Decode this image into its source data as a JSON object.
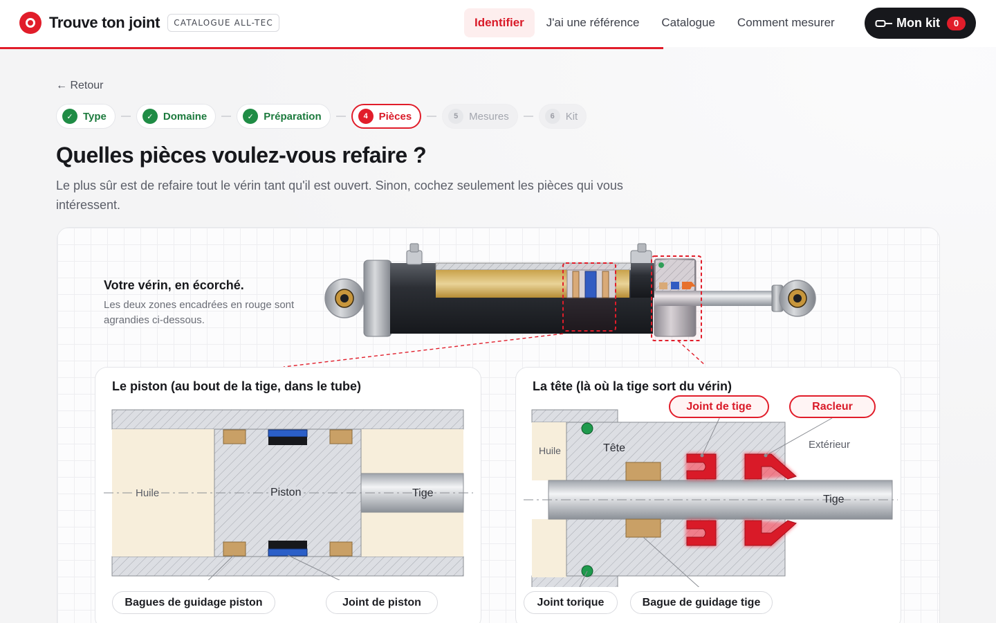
{
  "header": {
    "brand_name": "Trouve ton joint",
    "brand_badge": "CATALOGUE ALL-TEC",
    "nav": [
      {
        "label": "Identifier",
        "active": true
      },
      {
        "label": "J'ai une référence",
        "active": false
      },
      {
        "label": "Catalogue",
        "active": false
      },
      {
        "label": "Comment mesurer",
        "active": false
      }
    ],
    "kit_label": "Mon kit",
    "kit_count": "0",
    "accent": "#e11d2a"
  },
  "page": {
    "back_label": "← Retour",
    "steps": [
      {
        "num": "✓",
        "label": "Type",
        "state": "done"
      },
      {
        "num": "✓",
        "label": "Domaine",
        "state": "done"
      },
      {
        "num": "✓",
        "label": "Préparation",
        "state": "done"
      },
      {
        "num": "4",
        "label": "Pièces",
        "state": "current"
      },
      {
        "num": "5",
        "label": "Mesures",
        "state": "todo"
      },
      {
        "num": "6",
        "label": "Kit",
        "state": "todo"
      }
    ],
    "title": "Quelles pièces voulez-vous refaire ?",
    "lead": "Le plus sûr est de refaire tout le vérin tant qu'il est ouvert. Sinon, cochez seulement les pièces qui vous intéressent."
  },
  "overview": {
    "title": "Votre vérin, en écorché.",
    "subtitle": "Les deux zones encadrées en rouge sont agrandies ci-dessous."
  },
  "piston_panel": {
    "title": "Le piston (au bout de la tige, dans le tube)",
    "label_oil": "Huile",
    "label_piston": "Piston",
    "label_rod": "Tige",
    "pill_guide": "Bagues de guidage piston",
    "pill_seal": "Joint de piston"
  },
  "head_panel": {
    "title": "La tête (là où la tige sort du vérin)",
    "label_oil": "Huile",
    "label_head": "Tête",
    "label_outside": "Extérieur",
    "label_rod": "Tige",
    "pill_rod_seal": "Joint de tige",
    "pill_wiper": "Racleur",
    "pill_oring": "Joint torique",
    "pill_rod_guide": "Bague de guidage tige"
  }
}
